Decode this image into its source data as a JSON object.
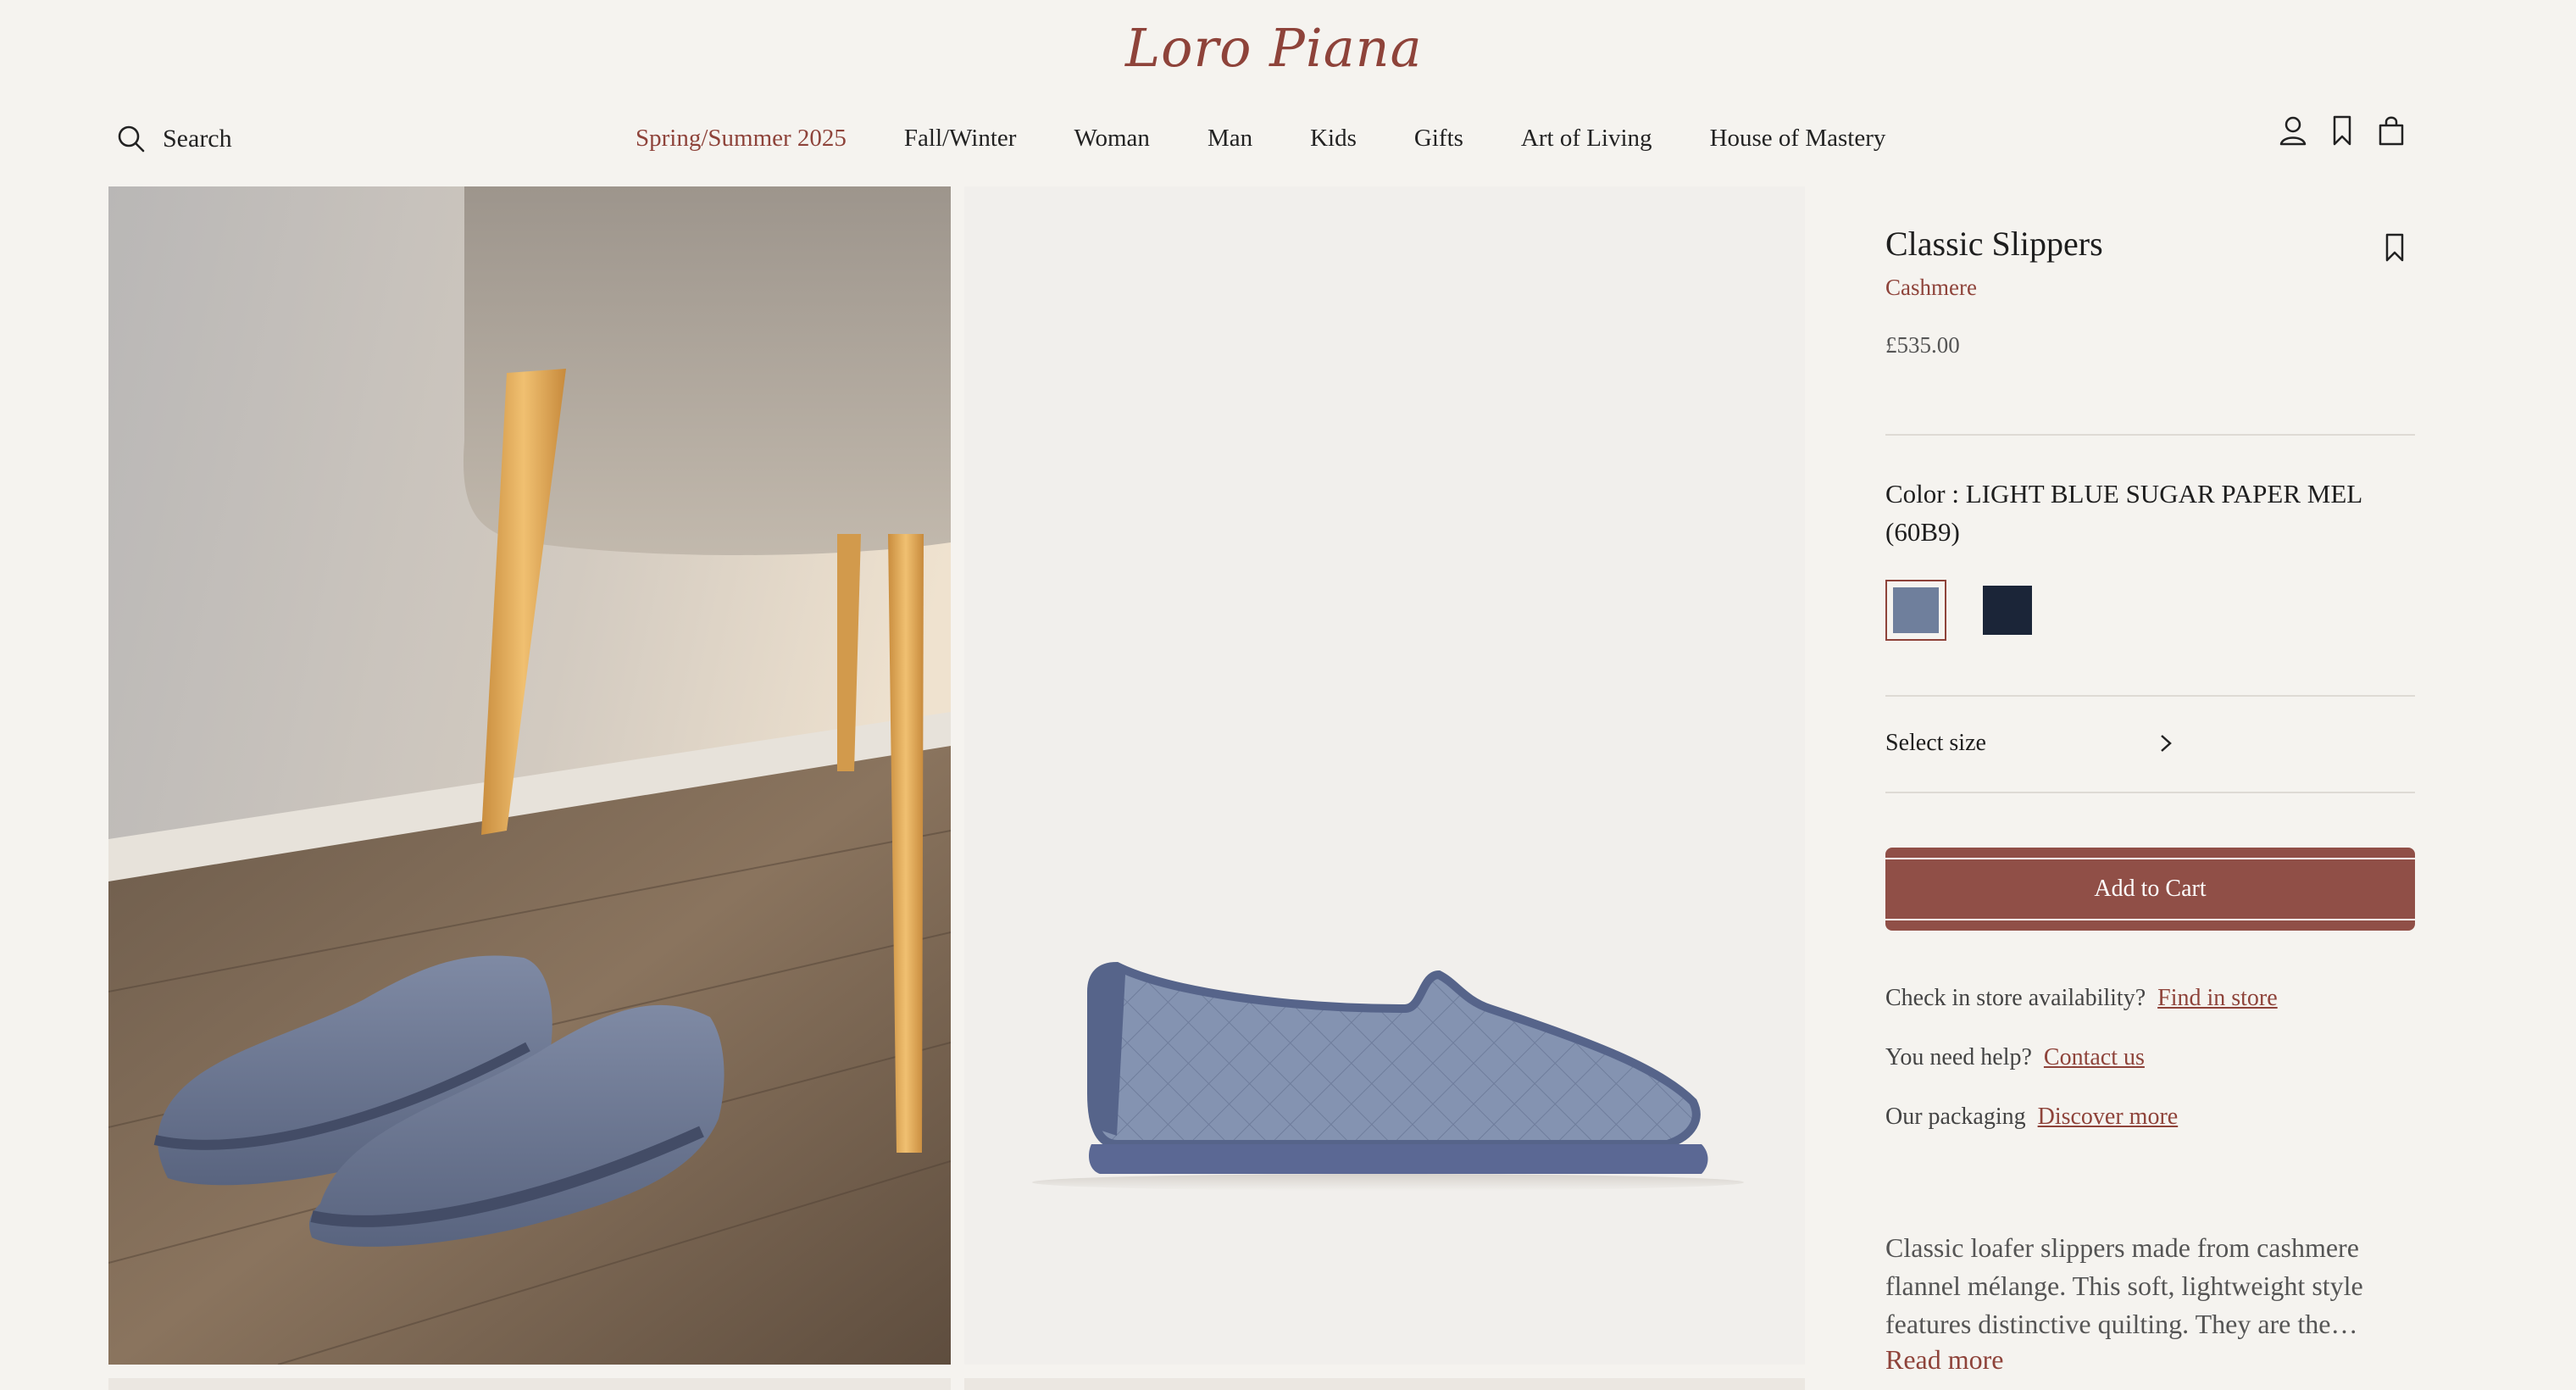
{
  "brand": {
    "name": "Loro Piana",
    "color": "#8e433a"
  },
  "header": {
    "search_label": "Search",
    "nav": [
      "Spring/Summer 2025",
      "Fall/Winter",
      "Woman",
      "Man",
      "Kids",
      "Gifts",
      "Art of Living",
      "House of Mastery"
    ],
    "active_nav": "Spring/Summer 2025",
    "icons": [
      "account-icon",
      "wishlist-icon",
      "shopping-bag-icon"
    ]
  },
  "gallery": {
    "images": [
      "slippers-lifestyle-image",
      "slipper-side-view-image"
    ]
  },
  "product": {
    "title": "Classic Slippers",
    "material": "Cashmere",
    "price": "£535.00",
    "color_label": "Color : LIGHT BLUE SUGAR PAPER MEL (60B9)",
    "swatches": [
      {
        "color": "#6f7f9c",
        "selected": true
      },
      {
        "color": "#1b2538",
        "selected": false
      }
    ],
    "size_label": "Select size",
    "add_to_cart": "Add to Cart",
    "store_question": "Check in store availability?",
    "store_link": "Find in store",
    "help_question": "You need help?",
    "help_link": "Contact us",
    "packaging_question": "Our packaging",
    "packaging_link": "Discover more",
    "description": "Classic loafer slippers made from cashmere flannel mélange. This soft, lightweight style features distinctive quilting. They are the…",
    "read_more": "Read more"
  }
}
